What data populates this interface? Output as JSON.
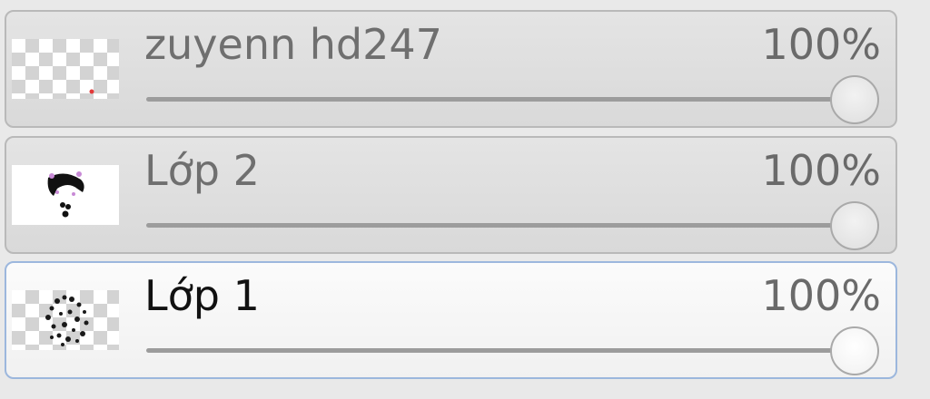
{
  "layers_panel": {
    "layers": [
      {
        "name": "zuyenn hd247",
        "opacity_label": "100%",
        "opacity_value": 100,
        "selected": false,
        "thumbnail": "transparent-with-red-dot"
      },
      {
        "name": "Lớp 2",
        "opacity_label": "100%",
        "opacity_value": 100,
        "selected": false,
        "thumbnail": "white-with-black-figure"
      },
      {
        "name": "Lớp 1",
        "opacity_label": "100%",
        "opacity_value": 100,
        "selected": true,
        "thumbnail": "transparent-with-dotted-pattern"
      }
    ],
    "colors": {
      "selected_border": "#9cb7dd",
      "panel_background": "#e9e9e9"
    }
  }
}
